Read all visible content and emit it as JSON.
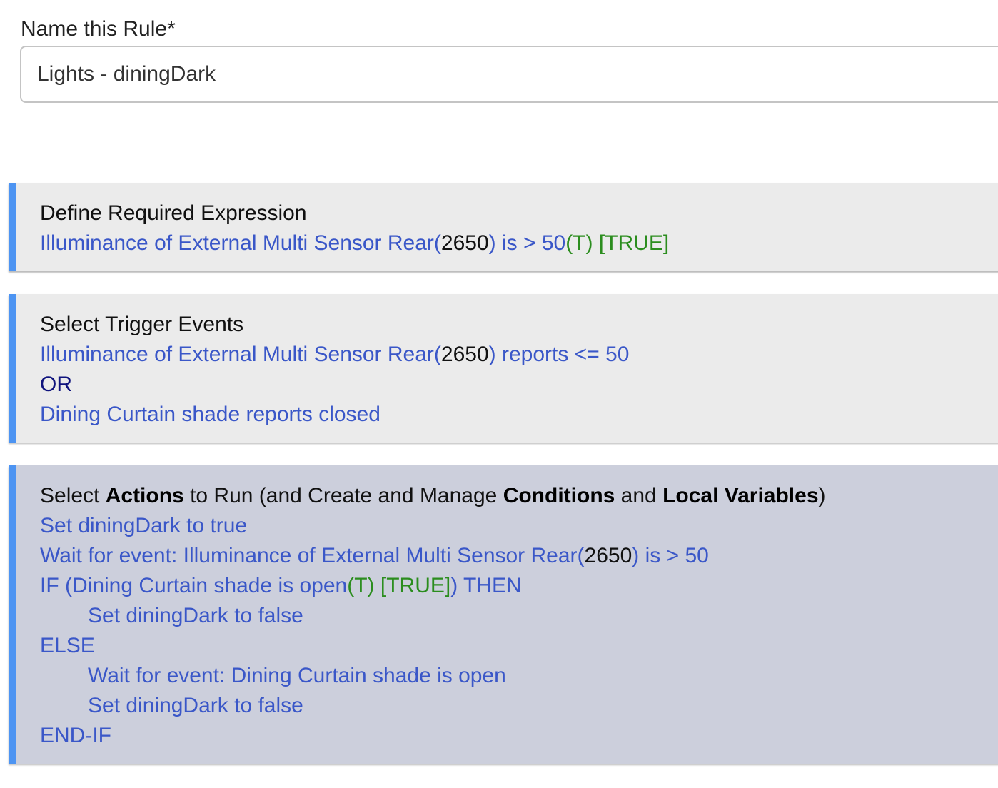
{
  "name_rule": {
    "label": "Name this Rule*",
    "value": "Lights - diningDark"
  },
  "required_expression": {
    "title": "Define Required Expression",
    "line1": {
      "prefix": "Illuminance of External Multi Sensor Rear(",
      "value": "2650",
      "mid": ") is > 50",
      "state": "(T)",
      "result": "[TRUE]"
    }
  },
  "trigger_events": {
    "title": "Select Trigger Events",
    "event1": {
      "prefix": "Illuminance of External Multi Sensor Rear(",
      "value": "2650",
      "suffix": ") reports <= 50"
    },
    "or_label": "OR",
    "event2": "Dining Curtain shade reports closed"
  },
  "actions": {
    "title_parts": {
      "p1": "Select ",
      "b1": "Actions",
      "p2": " to Run (and Create and Manage ",
      "b2": "Conditions",
      "p3": " and ",
      "b3": "Local Variables",
      "p4": ")"
    },
    "set_true": "Set diningDark to true",
    "wait_event": {
      "prefix": "Wait for event: Illuminance of External Multi Sensor Rear(",
      "value": "2650",
      "suffix": ") is > 50"
    },
    "if_line": {
      "prefix": "IF (Dining Curtain shade is open",
      "state": "(T)",
      "result": "[TRUE]",
      "suffix": ") THEN"
    },
    "set_false_1": "Set diningDark to false",
    "else_label": "ELSE",
    "wait_open": "Wait for event: Dining Curtain shade is open",
    "set_false_2": "Set diningDark to false",
    "endif_label": "END-IF"
  },
  "colors": {
    "accent_bar": "#4d94f2",
    "link_blue": "#3a57c8",
    "true_green": "#2b8d1e",
    "or_navy": "#10147e",
    "actions_bg": "#cccfdc",
    "section_bg": "#ebebeb"
  }
}
